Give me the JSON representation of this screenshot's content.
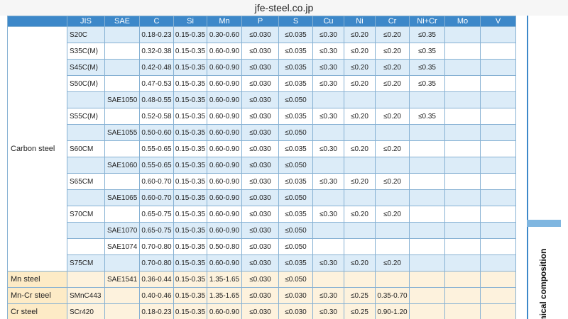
{
  "browser": {
    "url": "jfe-steel.co.jp"
  },
  "side": {
    "label": "hemical composition"
  },
  "columns": [
    "JIS",
    "SAE",
    "C",
    "Si",
    "Mn",
    "P",
    "S",
    "Cu",
    "Ni",
    "Cr",
    "Ni+Cr",
    "Mo",
    "V"
  ],
  "groups": [
    "Carbon steel",
    "Mn steel",
    "Mn-Cr steel",
    "Cr steel"
  ],
  "rows": [
    {
      "jis": "S20C",
      "sae": "",
      "c": "0.18-0.23",
      "si": "0.15-0.35",
      "mn": "0.30-0.60",
      "p": "≤0.030",
      "s": "≤0.035",
      "cu": "≤0.30",
      "ni": "≤0.20",
      "cr": "≤0.20",
      "nicr": "≤0.35",
      "mo": "",
      "v": ""
    },
    {
      "jis": "S35C(M)",
      "sae": "",
      "c": "0.32-0.38",
      "si": "0.15-0.35",
      "mn": "0.60-0.90",
      "p": "≤0.030",
      "s": "≤0.035",
      "cu": "≤0.30",
      "ni": "≤0.20",
      "cr": "≤0.20",
      "nicr": "≤0.35",
      "mo": "",
      "v": ""
    },
    {
      "jis": "S45C(M)",
      "sae": "",
      "c": "0.42-0.48",
      "si": "0.15-0.35",
      "mn": "0.60-0.90",
      "p": "≤0.030",
      "s": "≤0.035",
      "cu": "≤0.30",
      "ni": "≤0.20",
      "cr": "≤0.20",
      "nicr": "≤0.35",
      "mo": "",
      "v": ""
    },
    {
      "jis": "S50C(M)",
      "sae": "",
      "c": "0.47-0.53",
      "si": "0.15-0.35",
      "mn": "0.60-0.90",
      "p": "≤0.030",
      "s": "≤0.035",
      "cu": "≤0.30",
      "ni": "≤0.20",
      "cr": "≤0.20",
      "nicr": "≤0.35",
      "mo": "",
      "v": ""
    },
    {
      "jis": "",
      "sae": "SAE1050",
      "c": "0.48-0.55",
      "si": "0.15-0.35",
      "mn": "0.60-0.90",
      "p": "≤0.030",
      "s": "≤0.050",
      "cu": "",
      "ni": "",
      "cr": "",
      "nicr": "",
      "mo": "",
      "v": ""
    },
    {
      "jis": "S55C(M)",
      "sae": "",
      "c": "0.52-0.58",
      "si": "0.15-0.35",
      "mn": "0.60-0.90",
      "p": "≤0.030",
      "s": "≤0.035",
      "cu": "≤0.30",
      "ni": "≤0.20",
      "cr": "≤0.20",
      "nicr": "≤0.35",
      "mo": "",
      "v": ""
    },
    {
      "jis": "",
      "sae": "SAE1055",
      "c": "0.50-0.60",
      "si": "0.15-0.35",
      "mn": "0.60-0.90",
      "p": "≤0.030",
      "s": "≤0.050",
      "cu": "",
      "ni": "",
      "cr": "",
      "nicr": "",
      "mo": "",
      "v": ""
    },
    {
      "jis": "S60CM",
      "sae": "",
      "c": "0.55-0.65",
      "si": "0.15-0.35",
      "mn": "0.60-0.90",
      "p": "≤0.030",
      "s": "≤0.035",
      "cu": "≤0.30",
      "ni": "≤0.20",
      "cr": "≤0.20",
      "nicr": "",
      "mo": "",
      "v": ""
    },
    {
      "jis": "",
      "sae": "SAE1060",
      "c": "0.55-0.65",
      "si": "0.15-0.35",
      "mn": "0.60-0.90",
      "p": "≤0.030",
      "s": "≤0.050",
      "cu": "",
      "ni": "",
      "cr": "",
      "nicr": "",
      "mo": "",
      "v": ""
    },
    {
      "jis": "S65CM",
      "sae": "",
      "c": "0.60-0.70",
      "si": "0.15-0.35",
      "mn": "0.60-0.90",
      "p": "≤0.030",
      "s": "≤0.035",
      "cu": "≤0.30",
      "ni": "≤0.20",
      "cr": "≤0.20",
      "nicr": "",
      "mo": "",
      "v": ""
    },
    {
      "jis": "",
      "sae": "SAE1065",
      "c": "0.60-0.70",
      "si": "0.15-0.35",
      "mn": "0.60-0.90",
      "p": "≤0.030",
      "s": "≤0.050",
      "cu": "",
      "ni": "",
      "cr": "",
      "nicr": "",
      "mo": "",
      "v": ""
    },
    {
      "jis": "S70CM",
      "sae": "",
      "c": "0.65-0.75",
      "si": "0.15-0.35",
      "mn": "0.60-0.90",
      "p": "≤0.030",
      "s": "≤0.035",
      "cu": "≤0.30",
      "ni": "≤0.20",
      "cr": "≤0.20",
      "nicr": "",
      "mo": "",
      "v": ""
    },
    {
      "jis": "",
      "sae": "SAE1070",
      "c": "0.65-0.75",
      "si": "0.15-0.35",
      "mn": "0.60-0.90",
      "p": "≤0.030",
      "s": "≤0.050",
      "cu": "",
      "ni": "",
      "cr": "",
      "nicr": "",
      "mo": "",
      "v": ""
    },
    {
      "jis": "",
      "sae": "SAE1074",
      "c": "0.70-0.80",
      "si": "0.15-0.35",
      "mn": "0.50-0.80",
      "p": "≤0.030",
      "s": "≤0.050",
      "cu": "",
      "ni": "",
      "cr": "",
      "nicr": "",
      "mo": "",
      "v": ""
    },
    {
      "jis": "S75CM",
      "sae": "",
      "c": "0.70-0.80",
      "si": "0.15-0.35",
      "mn": "0.60-0.90",
      "p": "≤0.030",
      "s": "≤0.035",
      "cu": "≤0.30",
      "ni": "≤0.20",
      "cr": "≤0.20",
      "nicr": "",
      "mo": "",
      "v": ""
    },
    {
      "jis": "",
      "sae": "SAE1541",
      "c": "0.36-0.44",
      "si": "0.15-0.35",
      "mn": "1.35-1.65",
      "p": "≤0.030",
      "s": "≤0.050",
      "cu": "",
      "ni": "",
      "cr": "",
      "nicr": "",
      "mo": "",
      "v": ""
    },
    {
      "jis": "SMnC443",
      "sae": "",
      "c": "0.40-0.46",
      "si": "0.15-0.35",
      "mn": "1.35-1.65",
      "p": "≤0.030",
      "s": "≤0.030",
      "cu": "≤0.30",
      "ni": "≤0.25",
      "cr": "0.35-0.70",
      "nicr": "",
      "mo": "",
      "v": ""
    },
    {
      "jis": "SCr420",
      "sae": "",
      "c": "0.18-0.23",
      "si": "0.15-0.35",
      "mn": "0.60-0.90",
      "p": "≤0.030",
      "s": "≤0.030",
      "cu": "≤0.30",
      "ni": "≤0.25",
      "cr": "0.90-1.20",
      "nicr": "",
      "mo": "",
      "v": ""
    }
  ]
}
